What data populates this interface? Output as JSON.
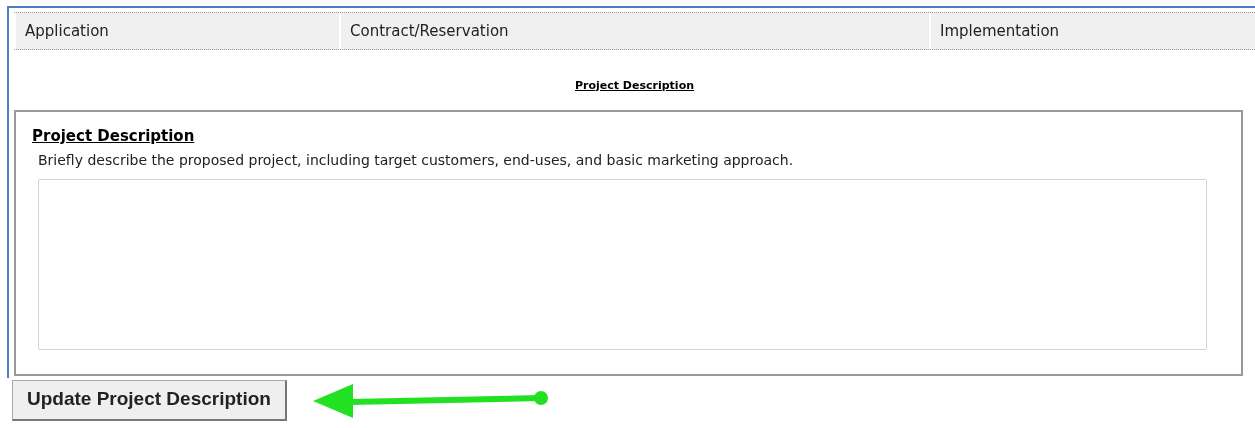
{
  "tabs": [
    {
      "label": "Application"
    },
    {
      "label": "Contract/Reservation"
    },
    {
      "label": "Implementation"
    }
  ],
  "page_title": "Project Description",
  "section": {
    "heading": "Project Description",
    "instructions": "Briefly describe the proposed project, including target customers, end-uses, and basic marketing approach."
  },
  "update_button": "Update Project Description"
}
